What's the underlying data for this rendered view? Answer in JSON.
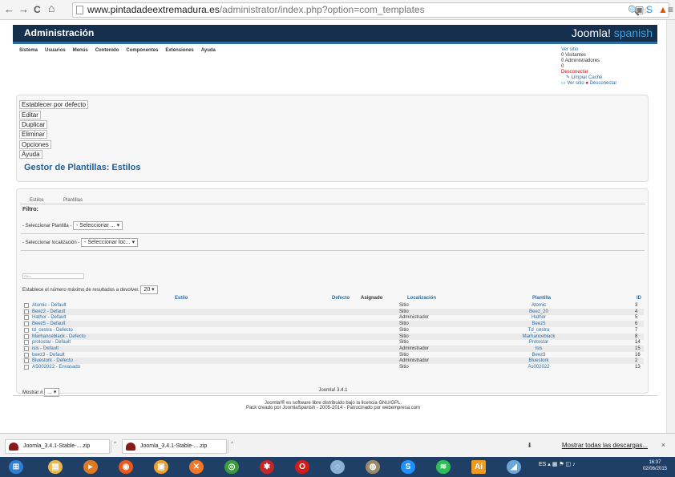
{
  "browser": {
    "url_domain": "www.pintadadeextremadura.es",
    "url_path": "/administrator/index.php?option=com_templates",
    "nav": {
      "back": "←",
      "forward": "→",
      "reload": "C",
      "home": "⌂"
    }
  },
  "joomla": {
    "header_title": "Administración",
    "logo_text": "Joomla!",
    "logo_suffix": "spanish",
    "menu": [
      "Sistema",
      "Usuarios",
      "Menús",
      "Contenido",
      "Componentes",
      "Extensiones",
      "Ayuda"
    ],
    "status": {
      "view_site": "Ver sitio",
      "visitors": "Visitantes",
      "admins": "Administradores",
      "zero": "0",
      "logout_short": "Desconectar",
      "clear_cache": "Limpiar Caché",
      "view_site_2": "Ver sitio",
      "logout": "Desconectar"
    }
  },
  "toolbar": {
    "buttons": [
      "Establecer por defecto",
      "Editar",
      "Duplicar",
      "Eliminar",
      "Opciones",
      "Ayuda"
    ],
    "page_title": "Gestor de Plantillas: Estilos"
  },
  "panel": {
    "tabs": [
      "Estilos",
      "Plantillas"
    ],
    "filter_label": "Filtro:",
    "select_template_label": "- Seleccionar Plantilla -",
    "select_template_value": "- Seleccionar ...",
    "select_location_label": "- Seleccionar localización -",
    "select_location_value": "- Seleccionar loc...",
    "search_placeholder": "Filtro",
    "max_results_label": "Establece el número máximo de resultados a devolver.",
    "max_results_value": "20",
    "show_label": "Mostrar #",
    "show_value": "..."
  },
  "table": {
    "headers": {
      "style": "Estilo",
      "default": "Defecto",
      "assigned": "Asignado",
      "location": "Localización",
      "template": "Plantilla",
      "id": "ID"
    },
    "rows": [
      {
        "name": "Atomic - Default",
        "location": "Sitio",
        "template": "Atomic",
        "id": "3"
      },
      {
        "name": "Beez2 - Default",
        "location": "Sitio",
        "template": "Beez_20",
        "id": "4"
      },
      {
        "name": "Hathor - Default",
        "location": "Administrador",
        "template": "Hathor",
        "id": "5"
      },
      {
        "name": "Beez5 - Default",
        "location": "Sitio",
        "template": "Beez5",
        "id": "6"
      },
      {
        "name": "td_cestra - Defecto",
        "location": "Sitio",
        "template": "Td_cestra",
        "id": "7"
      },
      {
        "name": "Marhanceblack - Defecto",
        "location": "Sitio",
        "template": "Marhanceblack",
        "id": "8"
      },
      {
        "name": "protostar - Default",
        "location": "Sitio",
        "template": "Protostar",
        "id": "14"
      },
      {
        "name": "isis - Default",
        "location": "Administrador",
        "template": "Isis",
        "id": "15"
      },
      {
        "name": "beez3 - Default",
        "location": "Sitio",
        "template": "Beez3",
        "id": "16"
      },
      {
        "name": "Bluestork - Defecto",
        "location": "Administrador",
        "template": "Bluestork",
        "id": "2"
      },
      {
        "name": "AS002022 - Envasado",
        "location": "Sitio",
        "template": "As002022",
        "id": "13"
      }
    ]
  },
  "footer": {
    "version": "Joomla! 3.4.1",
    "license": "Joomla!® es software libre distribuido bajo la licencia GNU/GPL.",
    "credit": "Pack creado por JoomlaSpanish - 2005-2014 - Patrocinado por webempresa.com"
  },
  "downloads": {
    "items": [
      "Joomla_3.4.1-Stable-....zip",
      "Joomla_3.4.1-Stable-....zip"
    ],
    "show_all": "Mostrar todas las descargas...",
    "close": "×"
  },
  "taskbar": {
    "lang": "ES",
    "time": "16:37",
    "date": "02/06/2015"
  },
  "colors": {
    "joomla_header": "#162f4d",
    "link_blue": "#2d6ca2",
    "taskbar": "#1f3f66"
  }
}
